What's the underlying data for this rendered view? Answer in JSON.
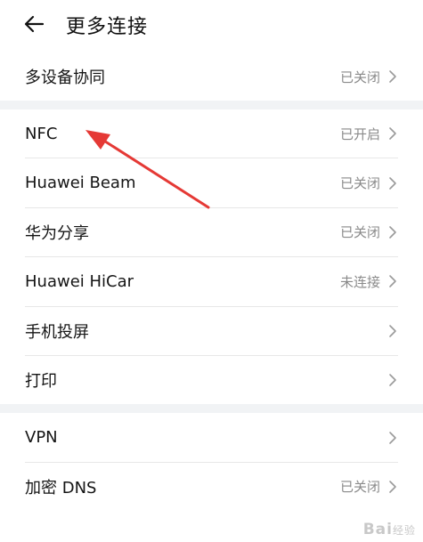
{
  "header": {
    "title": "更多连接"
  },
  "groups": [
    {
      "items": [
        {
          "label": "多设备协同",
          "status": "已关闭"
        }
      ]
    },
    {
      "items": [
        {
          "label": "NFC",
          "status": "已开启"
        },
        {
          "label": "Huawei Beam",
          "status": "已关闭"
        },
        {
          "label": "华为分享",
          "status": "已关闭"
        },
        {
          "label": "Huawei HiCar",
          "status": "未连接"
        },
        {
          "label": "手机投屏",
          "status": ""
        },
        {
          "label": "打印",
          "status": ""
        }
      ]
    },
    {
      "items": [
        {
          "label": "VPN",
          "status": ""
        },
        {
          "label": "加密 DNS",
          "status": "已关闭"
        }
      ]
    }
  ],
  "annotation": {
    "color": "#e53935"
  },
  "watermark": {
    "brand": "Bai",
    "suffix": "经验"
  }
}
